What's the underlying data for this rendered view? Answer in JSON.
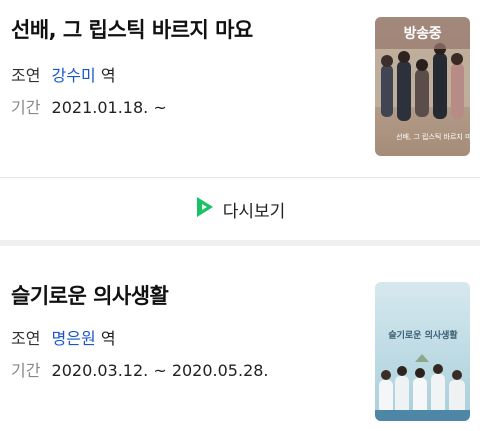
{
  "items": [
    {
      "title": "선배, 그 립스틱 바르지 마요",
      "cast_label": "조연",
      "cast_name": "강수미",
      "cast_suffix": "역",
      "period_label": "기간",
      "period": "2021.01.18. ~",
      "badge": "방송중",
      "poster_text": "선배, 그 립스틱 바르지 마요"
    },
    {
      "title": "슬기로운 의사생활",
      "cast_label": "조연",
      "cast_name": "명은원",
      "cast_suffix": "역",
      "period_label": "기간",
      "period": "2020.03.12. ~ 2020.05.28.",
      "poster_text": "슬기로운 의사생활"
    }
  ],
  "rewatch": {
    "label": "다시보기",
    "icon": "play-icon",
    "icon_color": "#19c265"
  },
  "colors": {
    "link": "#1a56c8",
    "badge_bg": "#96786e"
  }
}
